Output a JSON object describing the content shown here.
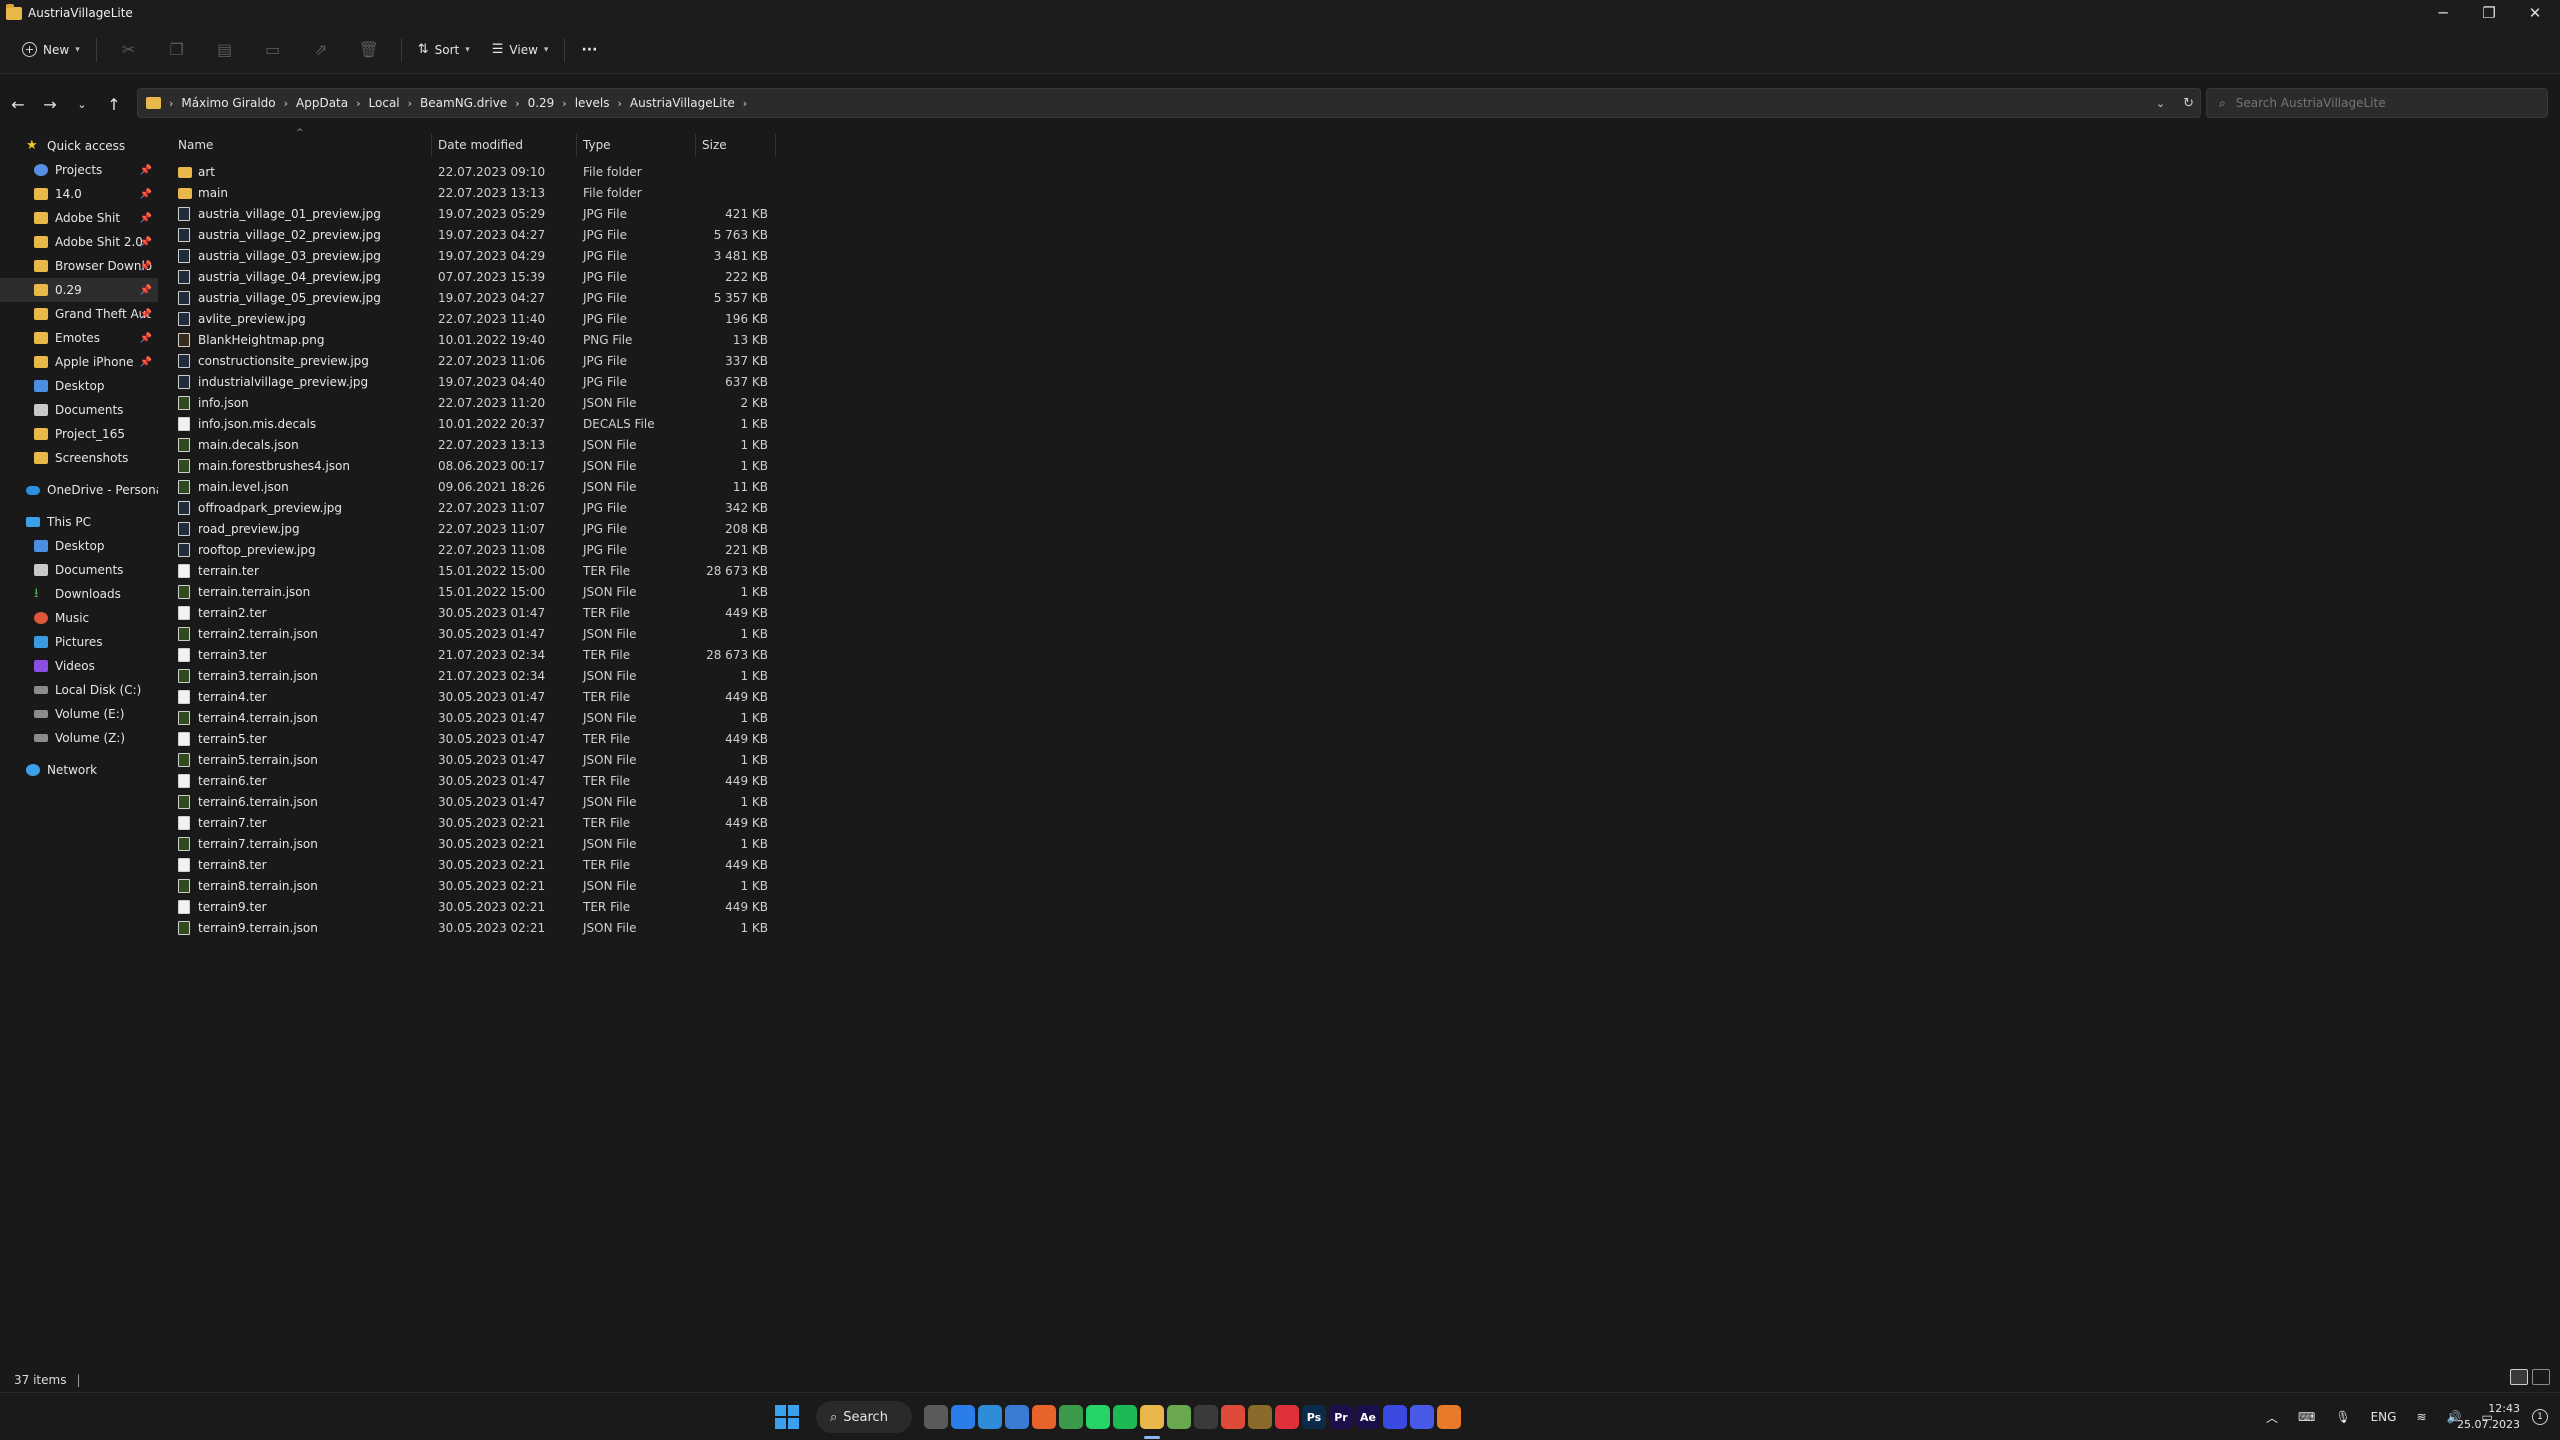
{
  "window": {
    "title": "AustriaVillageLite"
  },
  "toolbar": {
    "new_label": "New",
    "sort_label": "Sort",
    "view_label": "View",
    "more_label": "···"
  },
  "address": {
    "crumbs": [
      "Máximo Giraldo",
      "AppData",
      "Local",
      "BeamNG.drive",
      "0.29",
      "levels",
      "AustriaVillageLite"
    ]
  },
  "search": {
    "placeholder": "Search AustriaVillageLite"
  },
  "sidebar": {
    "items": [
      {
        "label": "Quick access",
        "icon": "star-icon"
      },
      {
        "label": "Projects",
        "icon": "projects-icon",
        "pinned": true
      },
      {
        "label": "14.0",
        "icon": "folder-icon",
        "pinned": true
      },
      {
        "label": "Adobe Shit",
        "icon": "folder-icon",
        "pinned": true
      },
      {
        "label": "Adobe Shit 2.0",
        "icon": "folder-icon",
        "pinned": true
      },
      {
        "label": "Browser Downlo",
        "icon": "folder-icon",
        "pinned": true
      },
      {
        "label": "0.29",
        "icon": "folder-icon",
        "pinned": true,
        "selected": true
      },
      {
        "label": "Grand Theft Aut",
        "icon": "folder-icon",
        "pinned": true
      },
      {
        "label": "Emotes",
        "icon": "folder-icon",
        "pinned": true
      },
      {
        "label": "Apple iPhone",
        "icon": "folder-icon",
        "pinned": true
      },
      {
        "label": "Desktop",
        "icon": "desktop-icon"
      },
      {
        "label": "Documents",
        "icon": "documents-icon"
      },
      {
        "label": "Project_165",
        "icon": "folder-icon"
      },
      {
        "label": "Screenshots",
        "icon": "folder-icon"
      },
      {
        "label": "OneDrive - Personal",
        "icon": "onedrive-icon"
      },
      {
        "label": "This PC",
        "icon": "pc-icon"
      },
      {
        "label": "Desktop",
        "icon": "desktop-icon"
      },
      {
        "label": "Documents",
        "icon": "documents-icon"
      },
      {
        "label": "Downloads",
        "icon": "downloads-icon"
      },
      {
        "label": "Music",
        "icon": "music-icon"
      },
      {
        "label": "Pictures",
        "icon": "pictures-icon"
      },
      {
        "label": "Videos",
        "icon": "videos-icon"
      },
      {
        "label": "Local Disk (C:)",
        "icon": "disk-icon"
      },
      {
        "label": "Volume (E:)",
        "icon": "disk-icon"
      },
      {
        "label": "Volume (Z:)",
        "icon": "disk-icon"
      },
      {
        "label": "Network",
        "icon": "network-icon"
      }
    ]
  },
  "columns": {
    "name": "Name",
    "date": "Date modified",
    "type": "Type",
    "size": "Size"
  },
  "files": [
    {
      "name": "art",
      "date": "22.07.2023 09:10",
      "type": "File folder",
      "size": "",
      "kind": "folder"
    },
    {
      "name": "main",
      "date": "22.07.2023 13:13",
      "type": "File folder",
      "size": "",
      "kind": "folder"
    },
    {
      "name": "austria_village_01_preview.jpg",
      "date": "19.07.2023 05:29",
      "type": "JPG File",
      "size": "421 KB",
      "kind": "jpg"
    },
    {
      "name": "austria_village_02_preview.jpg",
      "date": "19.07.2023 04:27",
      "type": "JPG File",
      "size": "5 763 KB",
      "kind": "jpg"
    },
    {
      "name": "austria_village_03_preview.jpg",
      "date": "19.07.2023 04:29",
      "type": "JPG File",
      "size": "3 481 KB",
      "kind": "jpg"
    },
    {
      "name": "austria_village_04_preview.jpg",
      "date": "07.07.2023 15:39",
      "type": "JPG File",
      "size": "222 KB",
      "kind": "jpg"
    },
    {
      "name": "austria_village_05_preview.jpg",
      "date": "19.07.2023 04:27",
      "type": "JPG File",
      "size": "5 357 KB",
      "kind": "jpg"
    },
    {
      "name": "avlite_preview.jpg",
      "date": "22.07.2023 11:40",
      "type": "JPG File",
      "size": "196 KB",
      "kind": "jpg"
    },
    {
      "name": "BlankHeightmap.png",
      "date": "10.01.2022 19:40",
      "type": "PNG File",
      "size": "13 KB",
      "kind": "png"
    },
    {
      "name": "constructionsite_preview.jpg",
      "date": "22.07.2023 11:06",
      "type": "JPG File",
      "size": "337 KB",
      "kind": "jpg"
    },
    {
      "name": "industrialvillage_preview.jpg",
      "date": "19.07.2023 04:40",
      "type": "JPG File",
      "size": "637 KB",
      "kind": "jpg"
    },
    {
      "name": "info.json",
      "date": "22.07.2023 11:20",
      "type": "JSON File",
      "size": "2 KB",
      "kind": "json"
    },
    {
      "name": "info.json.mis.decals",
      "date": "10.01.2022 20:37",
      "type": "DECALS File",
      "size": "1 KB",
      "kind": "generic"
    },
    {
      "name": "main.decals.json",
      "date": "22.07.2023 13:13",
      "type": "JSON File",
      "size": "1 KB",
      "kind": "json"
    },
    {
      "name": "main.forestbrushes4.json",
      "date": "08.06.2023 00:17",
      "type": "JSON File",
      "size": "1 KB",
      "kind": "json"
    },
    {
      "name": "main.level.json",
      "date": "09.06.2021 18:26",
      "type": "JSON File",
      "size": "11 KB",
      "kind": "json"
    },
    {
      "name": "offroadpark_preview.jpg",
      "date": "22.07.2023 11:07",
      "type": "JPG File",
      "size": "342 KB",
      "kind": "jpg"
    },
    {
      "name": "road_preview.jpg",
      "date": "22.07.2023 11:07",
      "type": "JPG File",
      "size": "208 KB",
      "kind": "jpg"
    },
    {
      "name": "rooftop_preview.jpg",
      "date": "22.07.2023 11:08",
      "type": "JPG File",
      "size": "221 KB",
      "kind": "jpg"
    },
    {
      "name": "terrain.ter",
      "date": "15.01.2022 15:00",
      "type": "TER File",
      "size": "28 673 KB",
      "kind": "generic"
    },
    {
      "name": "terrain.terrain.json",
      "date": "15.01.2022 15:00",
      "type": "JSON File",
      "size": "1 KB",
      "kind": "json"
    },
    {
      "name": "terrain2.ter",
      "date": "30.05.2023 01:47",
      "type": "TER File",
      "size": "449 KB",
      "kind": "generic"
    },
    {
      "name": "terrain2.terrain.json",
      "date": "30.05.2023 01:47",
      "type": "JSON File",
      "size": "1 KB",
      "kind": "json"
    },
    {
      "name": "terrain3.ter",
      "date": "21.07.2023 02:34",
      "type": "TER File",
      "size": "28 673 KB",
      "kind": "generic"
    },
    {
      "name": "terrain3.terrain.json",
      "date": "21.07.2023 02:34",
      "type": "JSON File",
      "size": "1 KB",
      "kind": "json"
    },
    {
      "name": "terrain4.ter",
      "date": "30.05.2023 01:47",
      "type": "TER File",
      "size": "449 KB",
      "kind": "generic"
    },
    {
      "name": "terrain4.terrain.json",
      "date": "30.05.2023 01:47",
      "type": "JSON File",
      "size": "1 KB",
      "kind": "json"
    },
    {
      "name": "terrain5.ter",
      "date": "30.05.2023 01:47",
      "type": "TER File",
      "size": "449 KB",
      "kind": "generic"
    },
    {
      "name": "terrain5.terrain.json",
      "date": "30.05.2023 01:47",
      "type": "JSON File",
      "size": "1 KB",
      "kind": "json"
    },
    {
      "name": "terrain6.ter",
      "date": "30.05.2023 01:47",
      "type": "TER File",
      "size": "449 KB",
      "kind": "generic"
    },
    {
      "name": "terrain6.terrain.json",
      "date": "30.05.2023 01:47",
      "type": "JSON File",
      "size": "1 KB",
      "kind": "json"
    },
    {
      "name": "terrain7.ter",
      "date": "30.05.2023 02:21",
      "type": "TER File",
      "size": "449 KB",
      "kind": "generic"
    },
    {
      "name": "terrain7.terrain.json",
      "date": "30.05.2023 02:21",
      "type": "JSON File",
      "size": "1 KB",
      "kind": "json"
    },
    {
      "name": "terrain8.ter",
      "date": "30.05.2023 02:21",
      "type": "TER File",
      "size": "449 KB",
      "kind": "generic"
    },
    {
      "name": "terrain8.terrain.json",
      "date": "30.05.2023 02:21",
      "type": "JSON File",
      "size": "1 KB",
      "kind": "json"
    },
    {
      "name": "terrain9.ter",
      "date": "30.05.2023 02:21",
      "type": "TER File",
      "size": "449 KB",
      "kind": "generic"
    },
    {
      "name": "terrain9.terrain.json",
      "date": "30.05.2023 02:21",
      "type": "JSON File",
      "size": "1 KB",
      "kind": "json"
    }
  ],
  "status": {
    "items_count": "37 items"
  },
  "taskbar": {
    "search_label": "Search",
    "apps": [
      {
        "name": "task-view",
        "label": "",
        "color": "#5a5a5a"
      },
      {
        "name": "mail",
        "label": "",
        "color": "#2b7de9"
      },
      {
        "name": "notepad",
        "label": "",
        "color": "#2f8cd8"
      },
      {
        "name": "store",
        "label": "",
        "color": "#3a7bd5"
      },
      {
        "name": "firefox",
        "label": "",
        "color": "#e8632b"
      },
      {
        "name": "chrome",
        "label": "",
        "color": "#3c9b4a"
      },
      {
        "name": "whatsapp",
        "label": "",
        "color": "#25d366"
      },
      {
        "name": "spotify",
        "label": "",
        "color": "#1db954"
      },
      {
        "name": "file-explorer",
        "label": "",
        "color": "#e8b94a"
      },
      {
        "name": "editor",
        "label": "",
        "color": "#6aa84f"
      },
      {
        "name": "steam",
        "label": "",
        "color": "#3a3a3a"
      },
      {
        "name": "app-a",
        "label": "",
        "color": "#e04a3a"
      },
      {
        "name": "app-b",
        "label": "",
        "color": "#8a6a2a"
      },
      {
        "name": "app-c",
        "label": "",
        "color": "#e0303a"
      },
      {
        "name": "photoshop",
        "label": "Ps",
        "color": "#0c2a4a"
      },
      {
        "name": "premiere",
        "label": "Pr",
        "color": "#1e0f4a"
      },
      {
        "name": "after-effects",
        "label": "Ae",
        "color": "#1a0f4a"
      },
      {
        "name": "app-d",
        "label": "",
        "color": "#3a4ae0"
      },
      {
        "name": "app-e",
        "label": "",
        "color": "#4a5ae8"
      },
      {
        "name": "blender",
        "label": "",
        "color": "#e87a2a"
      }
    ],
    "lang": "ENG",
    "time": "12:43",
    "date": "25.07.2023",
    "notification_count": "1"
  }
}
